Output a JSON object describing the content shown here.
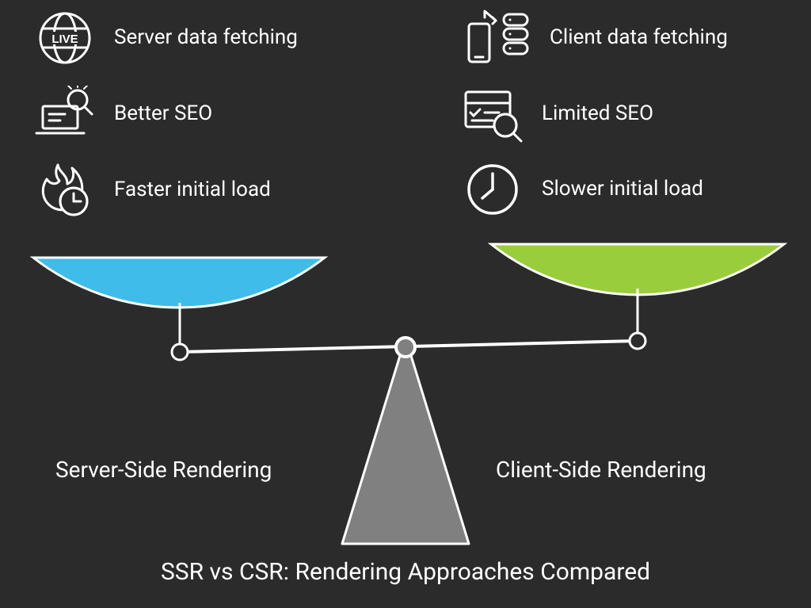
{
  "caption": "SSR vs CSR: Rendering Approaches Compared",
  "left": {
    "label": "Server-Side Rendering",
    "features": [
      {
        "text": "Server data fetching",
        "icon": "live-globe-icon"
      },
      {
        "text": "Better SEO",
        "icon": "seo-laptop-icon"
      },
      {
        "text": "Faster initial load",
        "icon": "fire-clock-icon"
      }
    ]
  },
  "right": {
    "label": "Client-Side Rendering",
    "features": [
      {
        "text": "Client data fetching",
        "icon": "phone-server-icon"
      },
      {
        "text": "Limited SEO",
        "icon": "browser-search-icon"
      },
      {
        "text": "Slower initial load",
        "icon": "clock-icon"
      }
    ]
  },
  "colors": {
    "leftPan": "#3fbce9",
    "rightPan": "#9acd3c",
    "stroke": "#ffffff",
    "base": "#808080"
  }
}
